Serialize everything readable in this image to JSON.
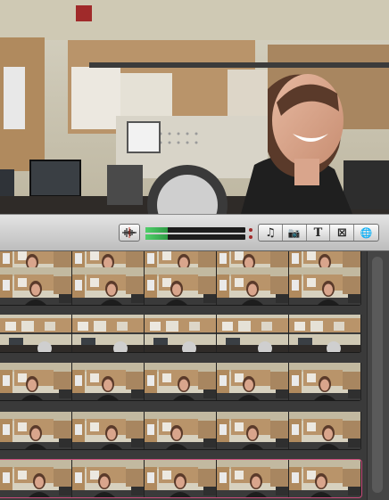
{
  "toolbar": {
    "audio_skimming_icon": "waveform-icon",
    "tools": [
      {
        "name": "music-icon",
        "glyph": "♫"
      },
      {
        "name": "camera-icon",
        "glyph": "📷"
      },
      {
        "name": "title-icon",
        "glyph": "T"
      },
      {
        "name": "transitions-icon",
        "glyph": "⊠"
      },
      {
        "name": "globe-icon",
        "glyph": "🌐"
      }
    ],
    "audio_level_left": 0.22,
    "audio_level_right": 0.22
  },
  "colors": {
    "meter_green": "#4fd06a",
    "selection": "#c94a7a",
    "wall": "#c9a67a"
  },
  "event_browser": {
    "clips": [
      {
        "frames": 5,
        "kind": "face",
        "partial": true
      },
      {
        "frames": 5,
        "kind": "face"
      },
      {
        "frames": 5,
        "kind": "room"
      },
      {
        "frames": 5,
        "kind": "face"
      },
      {
        "frames": 5,
        "kind": "face"
      },
      {
        "frames": 5,
        "kind": "face",
        "selected": true
      }
    ]
  }
}
